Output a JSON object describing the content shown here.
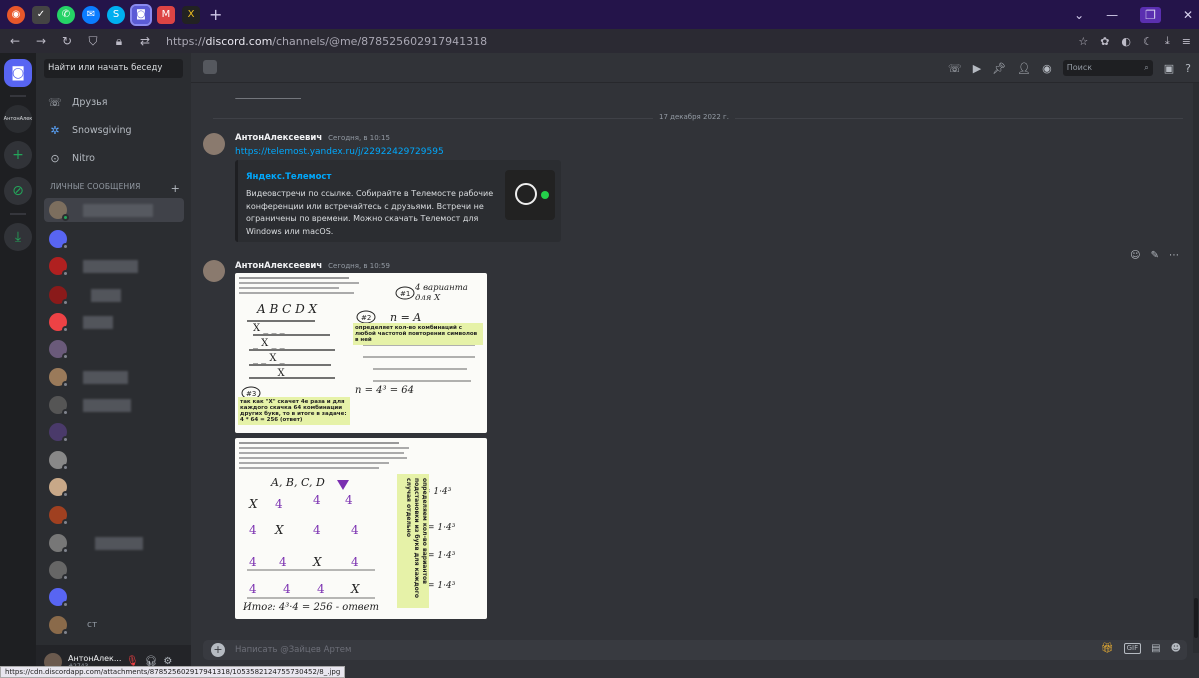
{
  "browser": {
    "tabs": [
      "firefox-icon",
      "check-icon",
      "whatsapp-icon",
      "messenger-icon",
      "skype-icon",
      "discord-icon",
      "gmail-icon",
      "x-icon"
    ],
    "new_tab": "+",
    "url_prefix": "https://",
    "url_domain": "discord.com",
    "url_path": "/channels/@me/878525602917941318"
  },
  "guilds": {
    "user_server": "АнтонАлек"
  },
  "sidebar": {
    "search_placeholder": "Найти или начать беседу",
    "items": [
      {
        "label": "Друзья",
        "icon": "friends-icon"
      },
      {
        "label": "Snowsgiving",
        "icon": "snowflake-icon"
      },
      {
        "label": "Nitro",
        "icon": "nitro-icon"
      }
    ],
    "dm_header": "ЛИЧНЫЕ СООБЩЕНИЯ",
    "dm_add": "+",
    "dm_partial_label": "ст"
  },
  "user_panel": {
    "name": "АнтонАлек...",
    "tag": "#2743"
  },
  "status_url": "https://cdn.discordapp.com/attachments/878525602917941318/1053582124755730452/8_.jpg",
  "topbar": {
    "search_placeholder": "Поиск"
  },
  "chat": {
    "separator_dashes": "‑‑‑‑‑‑‑‑‑‑‑‑‑‑‑‑‑‑‑‑‑‑‑‑‑‑‑‑‑‑‑‑‑‑‑‑‑‑‑‑‑‑‑‑‑‑‑‑‑‑‑‑‑‑‑‑",
    "date_divider": "17 декабря 2022 г.",
    "messages": [
      {
        "author": "АнтонАлексеевич",
        "time": "Сегодня, в 10:15",
        "link": "https://telemost.yandex.ru/j/22922429729595",
        "embed_title": "Яндекс.Телемост",
        "embed_desc": "Видеовстречи по ссылке. Собирайте в Телемосте рабочие конференции или встречайтесь с друзьями. Встречи не ограничены по времени. Можно скачать Телемост для Windows или macOS."
      },
      {
        "author": "АнтонАлексеевич",
        "time": "Сегодня, в 10:59",
        "img1_note1": "определяет кол-во комбинаций с любой частотой повторения символов в ней",
        "img1_note2": "так как \"X\" скачет 4е разa и для каждого скачка 64 комбинации других букв, то в итоге в задаче:\n4 * 64 = 256 (ответ)",
        "img2_note": "определяем кол-во вариантов подстановки из букв для каждого случая отдельно",
        "img1_ink": "4 варианта для X",
        "img1_formula": "n = 4³ = 64",
        "img2_ink": "Итог: 4³·4 = 256 - ответ"
      }
    ]
  },
  "composer": {
    "placeholder": "Написать @Зайцев Артем",
    "gif_label": "GIF"
  }
}
